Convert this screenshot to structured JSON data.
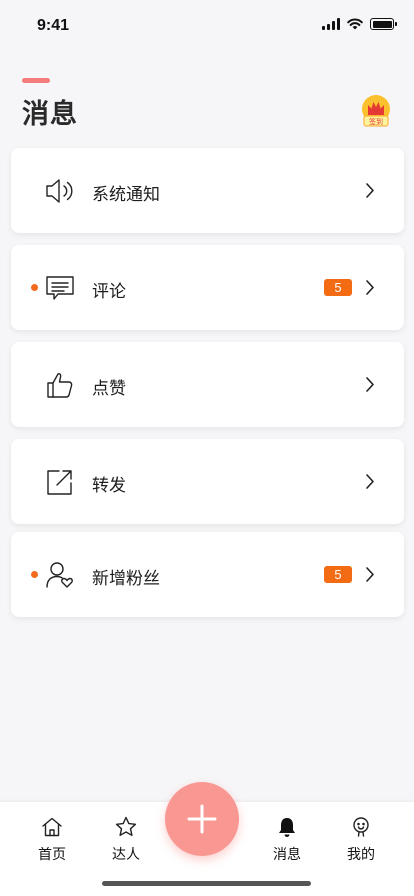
{
  "status_bar": {
    "time": "9:41"
  },
  "header": {
    "title": "消息",
    "sign_badge_text": "签到"
  },
  "items": [
    {
      "label": "系统通知",
      "icon": "speaker-icon",
      "unread_dot": false,
      "count": ""
    },
    {
      "label": "评论",
      "icon": "comment-icon",
      "unread_dot": true,
      "count": "5"
    },
    {
      "label": "点赞",
      "icon": "thumbs-up-icon",
      "unread_dot": false,
      "count": ""
    },
    {
      "label": "转发",
      "icon": "share-icon",
      "unread_dot": false,
      "count": ""
    },
    {
      "label": "新增粉丝",
      "icon": "follower-icon",
      "unread_dot": true,
      "count": "5"
    }
  ],
  "tab_bar": {
    "tabs": [
      {
        "label": "首页",
        "icon": "home-icon"
      },
      {
        "label": "达人",
        "icon": "star-icon"
      },
      {
        "label": "消息",
        "icon": "bell-icon",
        "active": true
      },
      {
        "label": "我的",
        "icon": "profile-icon"
      }
    ],
    "fab_icon": "plus-icon"
  },
  "colors": {
    "accent": "#f47c7c",
    "badge": "#f36b12",
    "dot": "#f26b1d",
    "fab": "#f99793"
  }
}
